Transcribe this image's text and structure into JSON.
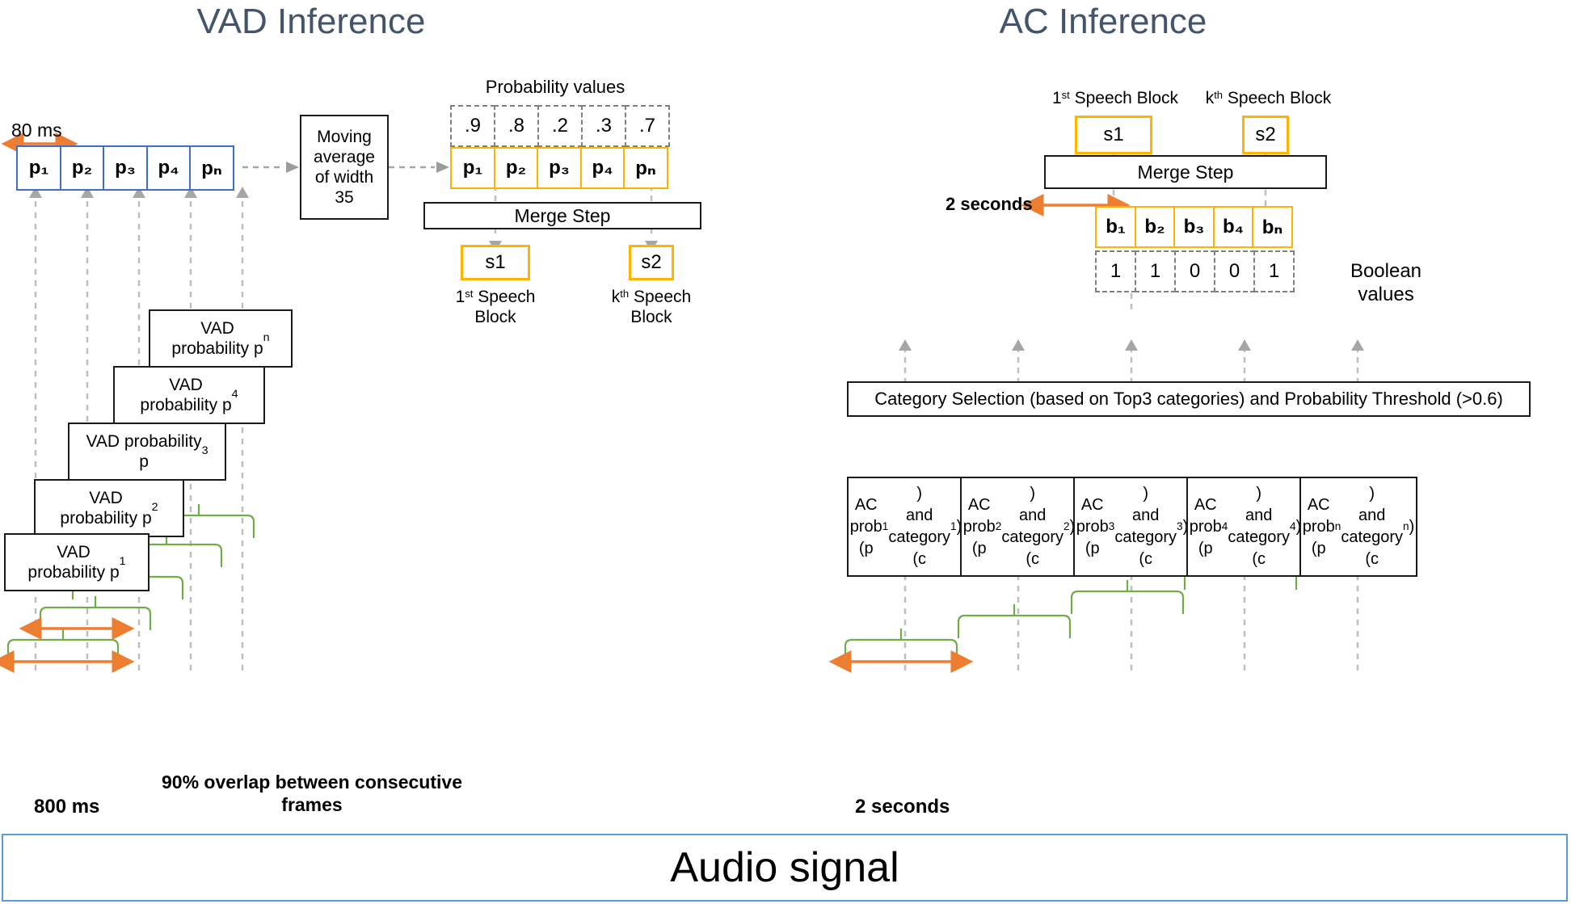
{
  "titles": {
    "vad": "VAD Inference",
    "ac": "AC Inference"
  },
  "vad": {
    "frame_duration_label": "80 ms",
    "prob_row": [
      "p₁",
      "p₂",
      "p₃",
      "p₄",
      "pₙ"
    ],
    "moving_average": "Moving average of width 35",
    "probability_values_title": "Probability values",
    "probability_values": [
      ".9",
      ".8",
      ".2",
      ".3",
      ".7"
    ],
    "smoothed_row": [
      "p₁",
      "p₂",
      "p₃",
      "p₄",
      "pₙ"
    ],
    "merge_step": "Merge Step",
    "speech_blocks": [
      "s1",
      "s2"
    ],
    "speech_block_labels": [
      "1st Speech Block",
      "kth Speech Block"
    ],
    "vad_prob_boxes": [
      "VAD probability p₁",
      "VAD probability p₂",
      "VAD probability p₃",
      "VAD probability p₄",
      "VAD probability pₙ"
    ],
    "overlap_note": "90% overlap between consecutive frames",
    "window_label": "800 ms"
  },
  "ac": {
    "speech_block_labels": [
      "1st Speech Block",
      "kth Speech Block"
    ],
    "speech_blocks": [
      "s1",
      "s2"
    ],
    "merge_step": "Merge Step",
    "window_label": "2 seconds",
    "bool_row": [
      "b₁",
      "b₂",
      "b₃",
      "b₄",
      "bₙ"
    ],
    "bool_values": [
      "1",
      "1",
      "0",
      "0",
      "1"
    ],
    "bool_caption": "Boolean values",
    "category_selection": "Category Selection (based on Top3 categories) and Probability Threshold (>0.6)",
    "ac_prob_boxes": [
      "AC prob (p₁) and category (c₁)",
      "AC prob (p₂) and category (c₂)",
      "AC prob (p₃) and category (c₃)",
      "AC prob (p₄) and category (c₄)",
      "AC prob (pₙ) and category (cₙ)"
    ],
    "bottom_window_label": "2 seconds"
  },
  "audio": {
    "label": "Audio signal"
  },
  "colors": {
    "title": "#44546A",
    "orange_accent": "#FFB400",
    "arrow_orange": "#ED7D31",
    "blue_border": "#3D6FC4",
    "audio_blue": "#5B9BD5",
    "green_brace": "#70AD47",
    "dash_gray": "#A6A6A6"
  }
}
